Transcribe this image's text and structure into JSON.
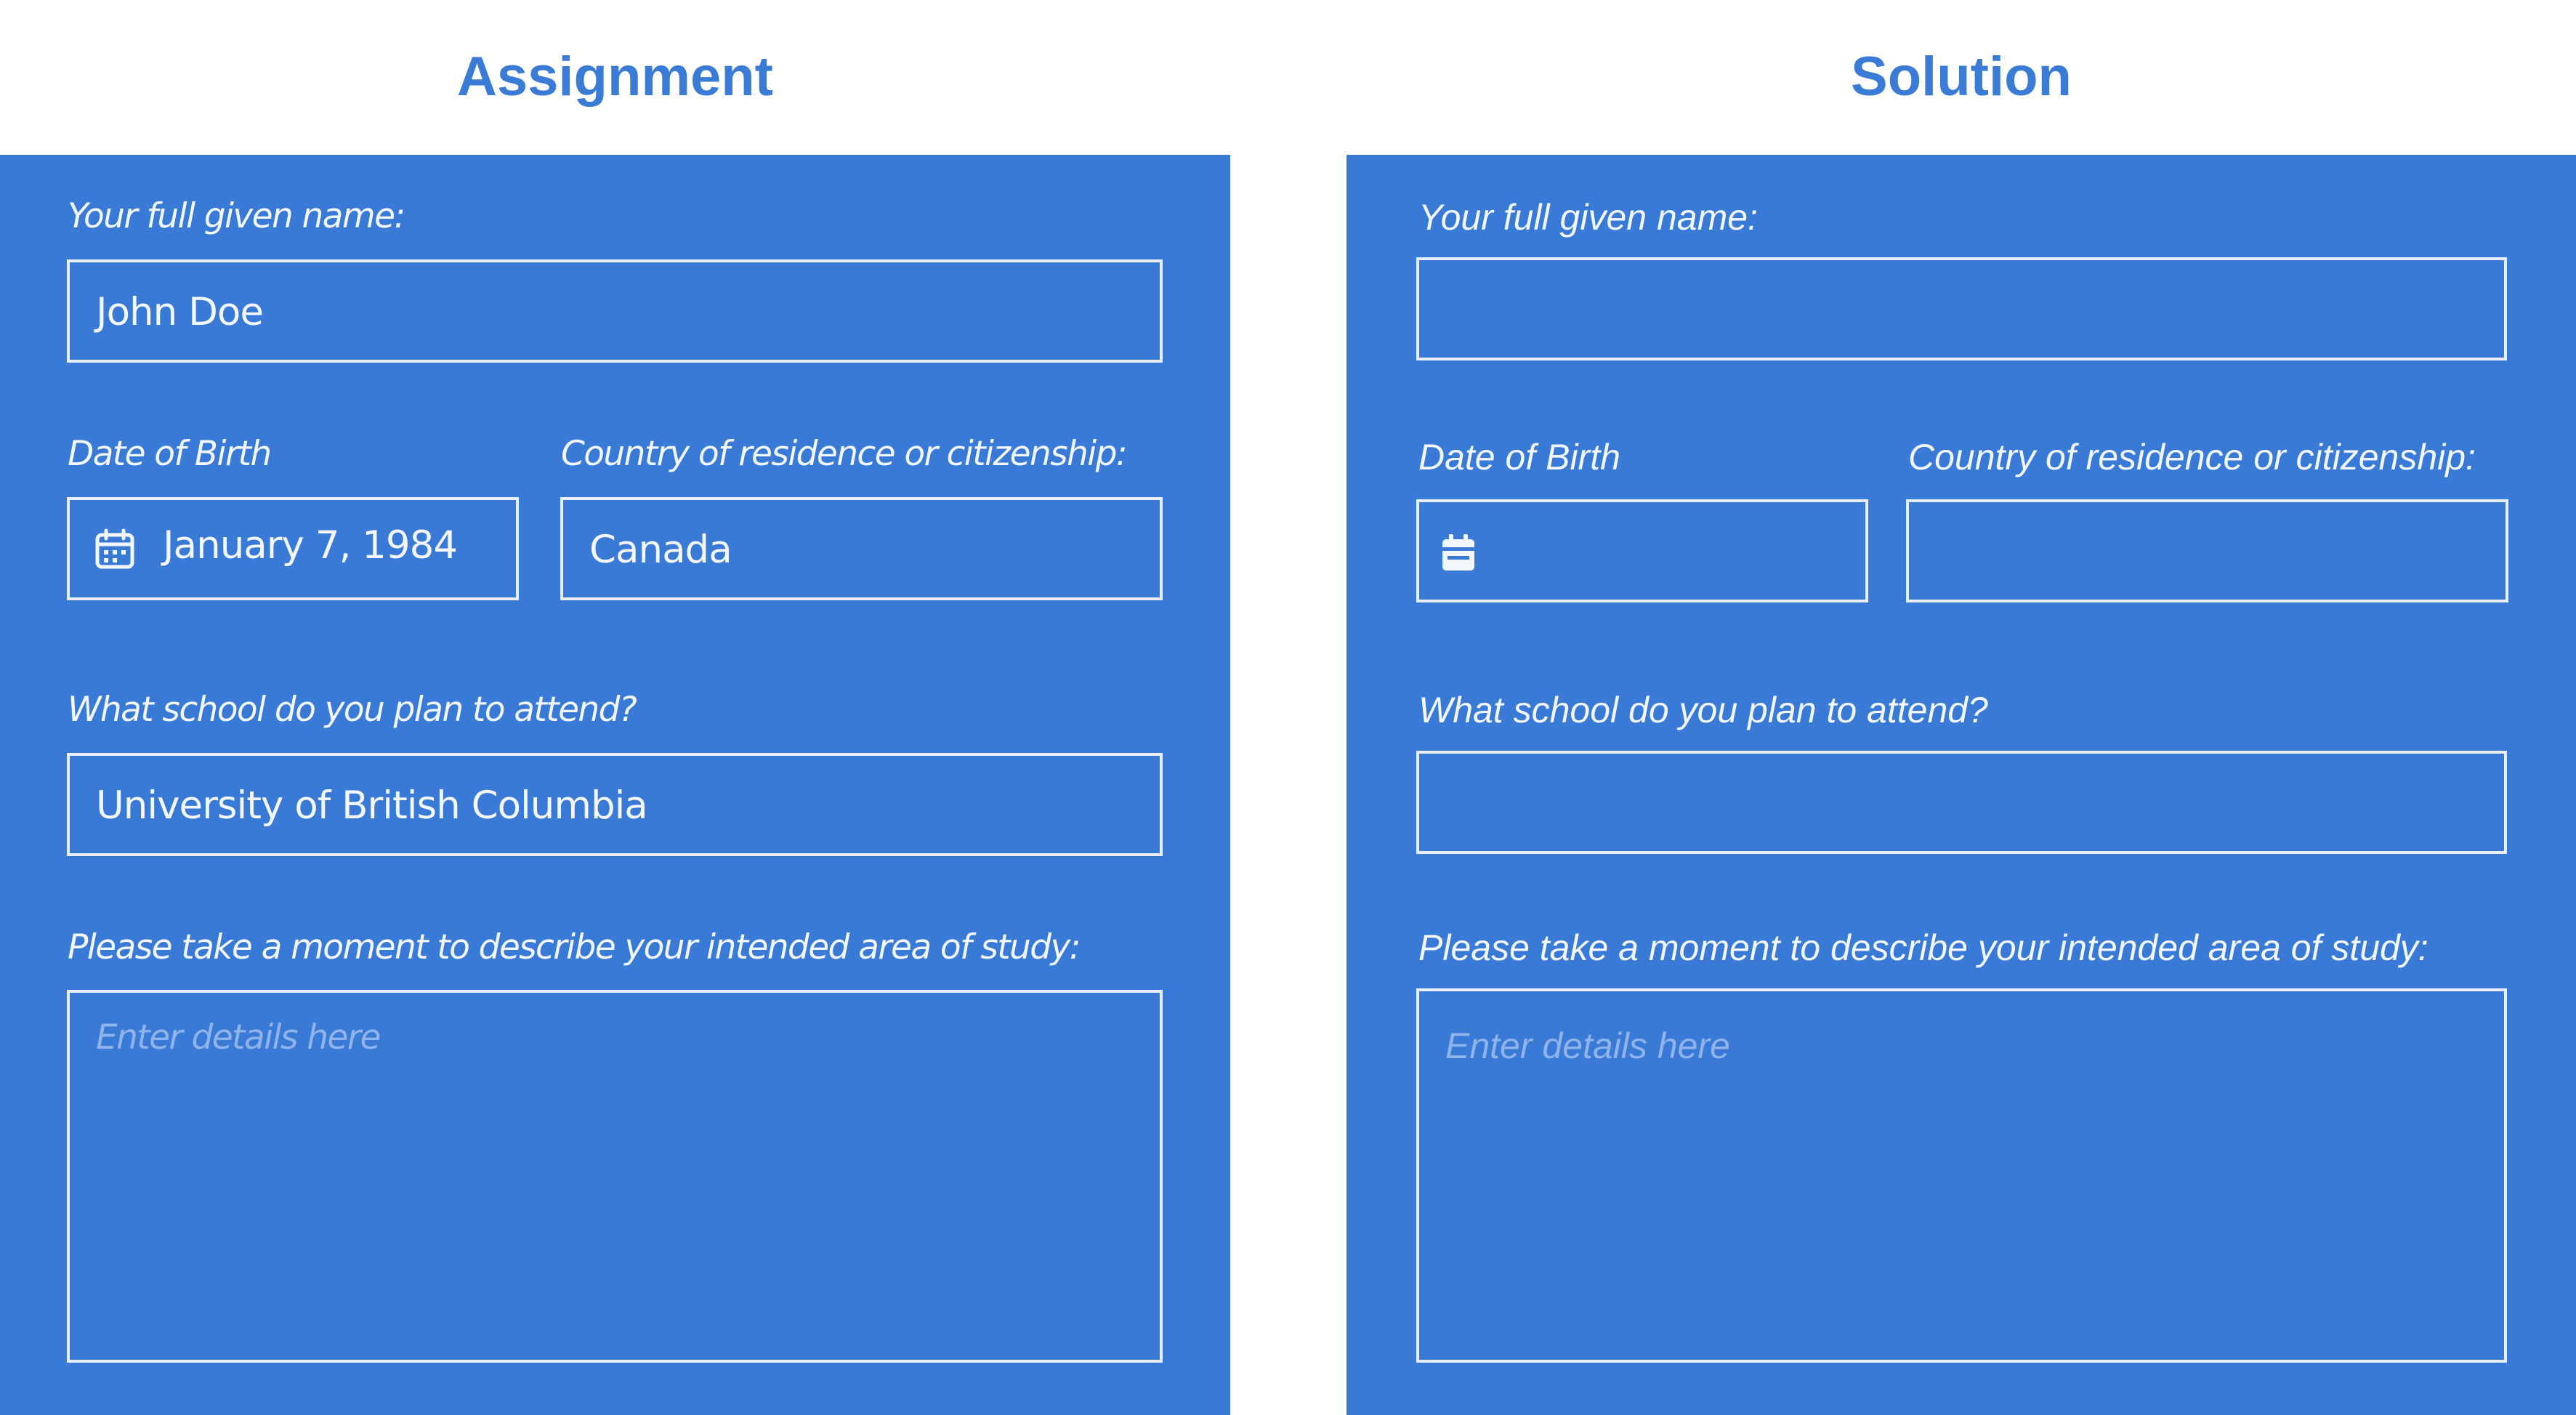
{
  "headings": {
    "assignment": "Assignment",
    "solution": "Solution"
  },
  "assignment": {
    "full_name_label": "Your full given name:",
    "full_name_value": "John Doe",
    "dob_label": "Date of Birth",
    "dob_value": "January 7, 1984",
    "dob_icon": "calendar-icon",
    "country_label": "Country of residence or citizenship:",
    "country_value": "Canada",
    "school_label": "What school do you plan to attend?",
    "school_value": "University of British Columbia",
    "study_label": "Please take a moment to describe your intended area of study:",
    "study_placeholder": "Enter details here"
  },
  "solution": {
    "full_name_label": "Your full given name:",
    "full_name_value": "",
    "dob_label": "Date of Birth",
    "dob_value": "",
    "dob_icon": "calendar-icon",
    "country_label": "Country of residence or citizenship:",
    "country_value": "",
    "school_label": "What school do you plan to attend?",
    "school_value": "",
    "study_label": "Please take a moment to describe your intended area of study:",
    "study_placeholder": "Enter details here"
  },
  "colors": {
    "heading": "#3a7bd5",
    "panel_background": "#387ad6",
    "field_border": "#e8effa",
    "text": "#f2f6fd",
    "placeholder": "#8fb3ea"
  }
}
